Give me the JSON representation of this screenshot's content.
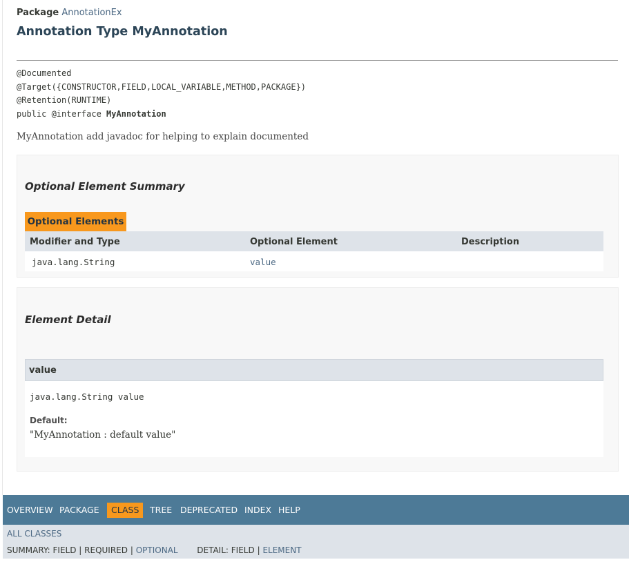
{
  "header": {
    "package_label": "Package",
    "package_name": "AnnotationEx",
    "title": "Annotation Type MyAnnotation"
  },
  "signature": {
    "lines": [
      "@Documented",
      "@Target({CONSTRUCTOR,FIELD,LOCAL_VARIABLE,METHOD,PACKAGE})",
      "@Retention(RUNTIME)"
    ],
    "decl_prefix": "public @interface ",
    "decl_name": "MyAnnotation"
  },
  "description": "MyAnnotation add javadoc for helping to explain documented",
  "summary": {
    "heading": "Optional Element Summary",
    "caption": "Optional Elements",
    "columns": [
      "Modifier and Type",
      "Optional Element",
      "Description"
    ],
    "rows": [
      {
        "type": "java.lang.String",
        "element": "value",
        "description": ""
      }
    ]
  },
  "detail": {
    "heading": "Element Detail",
    "name": "value",
    "signature": "java.lang.String value",
    "default_label": "Default:",
    "default_value": "\"MyAnnotation : default value\""
  },
  "nav": {
    "items": [
      "Overview",
      "Package",
      "Class",
      "Tree",
      "Deprecated",
      "Index",
      "Help"
    ],
    "active": "Class",
    "all_classes": "All Classes",
    "summary_label": "SUMMARY:",
    "summary_field": "FIELD",
    "summary_required": "REQUIRED",
    "summary_optional": "OPTIONAL",
    "detail_label": "DETAIL:",
    "detail_field": "FIELD",
    "detail_element": "ELEMENT",
    "sep": "|"
  }
}
